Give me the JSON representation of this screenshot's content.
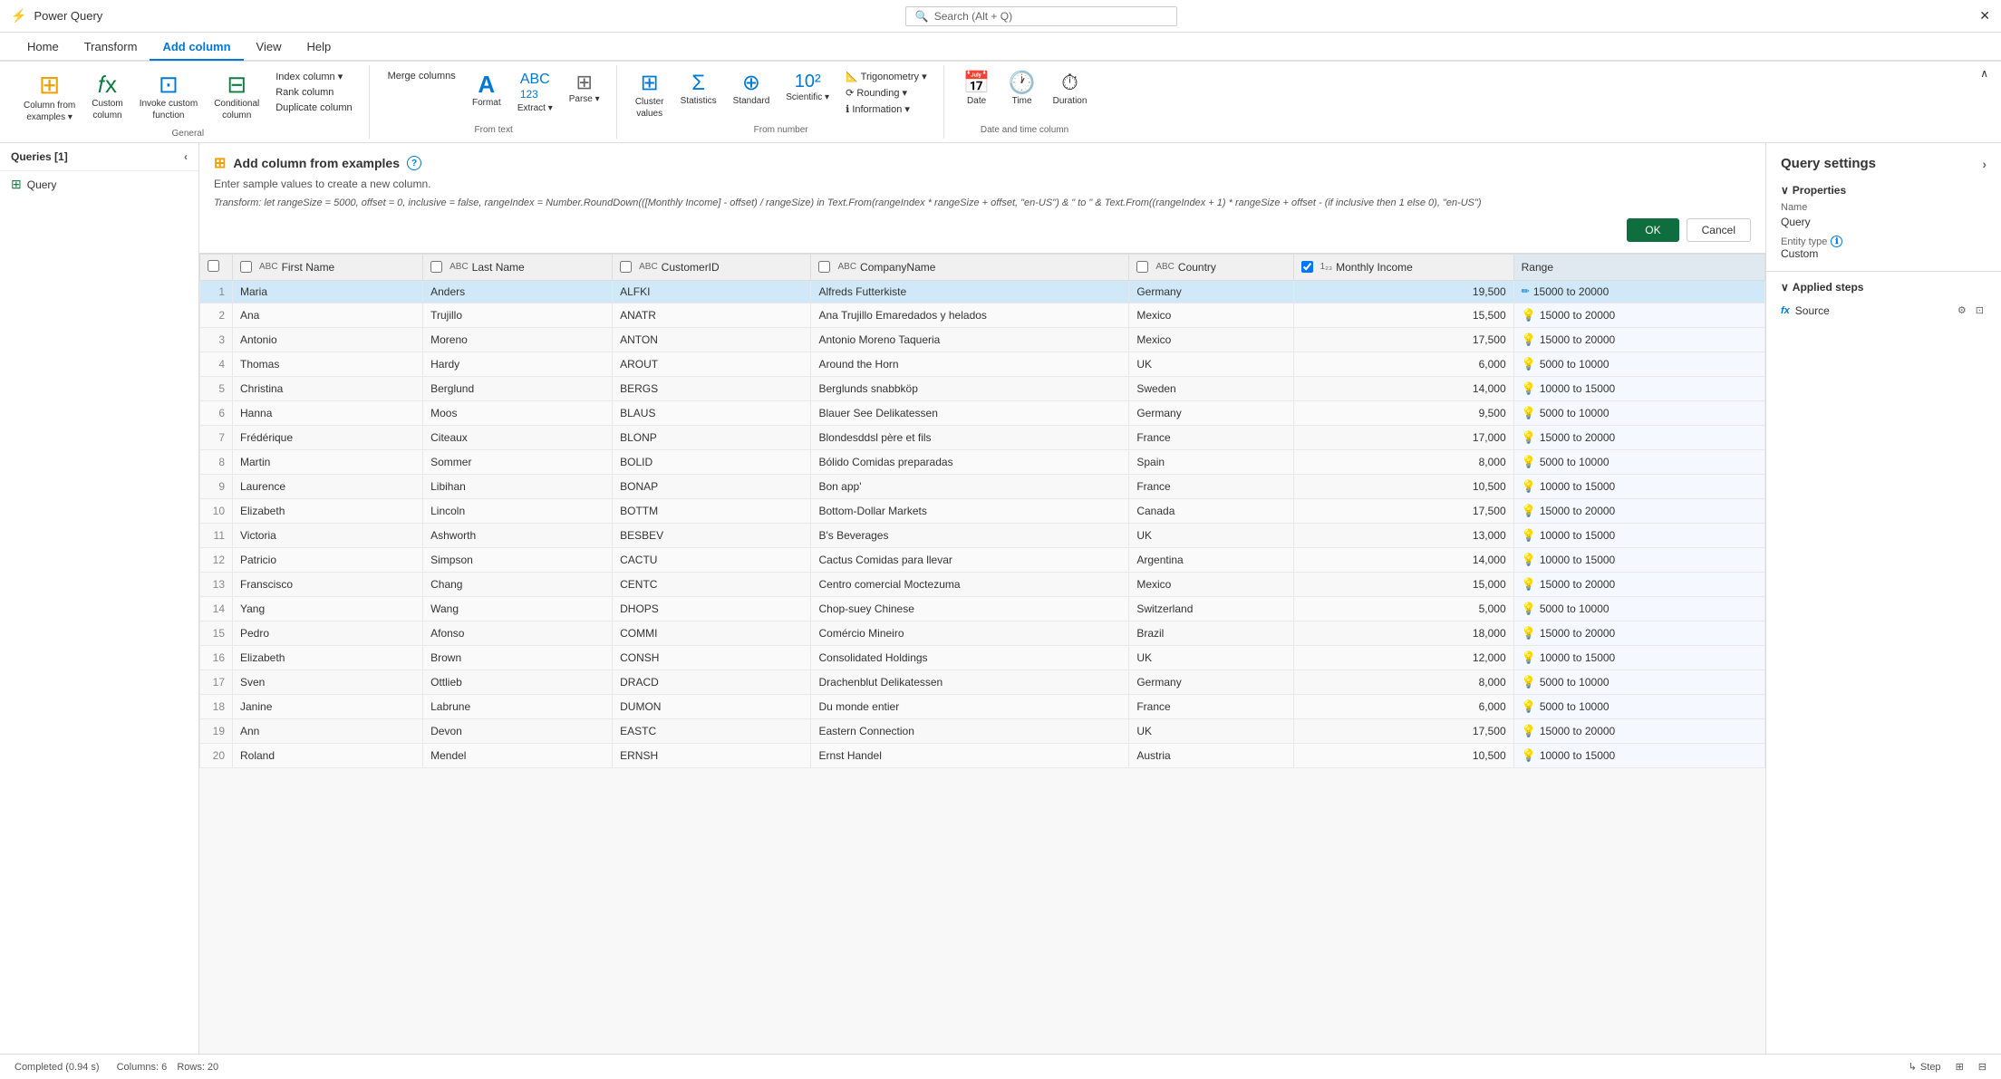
{
  "app": {
    "title": "Power Query",
    "close_label": "✕"
  },
  "search": {
    "placeholder": "Search (Alt + Q)"
  },
  "tabs": [
    {
      "label": "Home",
      "active": false
    },
    {
      "label": "Transform",
      "active": false
    },
    {
      "label": "Add column",
      "active": true
    },
    {
      "label": "View",
      "active": false
    },
    {
      "label": "Help",
      "active": false
    }
  ],
  "ribbon": {
    "groups": [
      {
        "label": "General",
        "items": [
          {
            "label": "Column from\nexamples",
            "icon": "⊞",
            "has_dropdown": true
          },
          {
            "label": "Custom\ncolumn",
            "icon": "𝑓x",
            "has_dropdown": false
          },
          {
            "label": "Invoke custom\nfunction",
            "icon": "⊡",
            "has_dropdown": false
          },
          {
            "label": "Conditional\ncolumn",
            "icon": "⊟",
            "has_dropdown": false
          }
        ],
        "small_items": [
          {
            "label": "Index column ▾"
          },
          {
            "label": "Rank column"
          },
          {
            "label": "Duplicate column"
          }
        ]
      },
      {
        "label": "From text",
        "items": [
          {
            "label": "Format",
            "icon": "A"
          },
          {
            "label": "Extract ▾",
            "icon": "ABC\n123"
          },
          {
            "label": "Parse ▾",
            "icon": "⊞"
          }
        ],
        "small_items": [
          {
            "label": "Merge columns"
          }
        ]
      },
      {
        "label": "From number",
        "items": [
          {
            "label": "Cluster\nvalues",
            "icon": "⊞"
          },
          {
            "label": "Statistics",
            "icon": "Σ"
          },
          {
            "label": "Standard",
            "icon": "σ"
          },
          {
            "label": "Scientific\n▾",
            "icon": "10²"
          }
        ],
        "small_items": [
          {
            "label": "Trigonometry ▾"
          },
          {
            "label": "Rounding ▾"
          },
          {
            "label": "Information ▾"
          }
        ]
      },
      {
        "label": "Date and time column",
        "items": [
          {
            "label": "Date",
            "icon": "📅"
          },
          {
            "label": "Time",
            "icon": "🕐"
          },
          {
            "label": "Duration",
            "icon": "⏱"
          }
        ],
        "small_items": []
      }
    ]
  },
  "queries_panel": {
    "title": "Queries [1]",
    "items": [
      {
        "label": "Query",
        "icon": "table"
      }
    ]
  },
  "examples_panel": {
    "title": "Add column from examples",
    "subtitle": "Enter sample values to create a new column.",
    "transform_label": "Transform:",
    "transform_text": "let rangeSize = 5000, offset = 0, inclusive = false, rangeIndex = Number.RoundDown(([Monthly Income] - offset) / rangeSize) in Text.From(rangeIndex * rangeSize + offset, \"en-US\") & \" to \" & Text.From((rangeIndex + 1) * rangeSize + offset - (if inclusive then 1 else 0), \"en-US\")",
    "ok_label": "OK",
    "cancel_label": "Cancel",
    "info_tooltip": "?"
  },
  "table": {
    "columns": [
      {
        "label": "",
        "type": ""
      },
      {
        "label": "First Name",
        "type": "ABC",
        "checked": false
      },
      {
        "label": "Last Name",
        "type": "ABC",
        "checked": false
      },
      {
        "label": "CustomerID",
        "type": "ABC",
        "checked": false
      },
      {
        "label": "CompanyName",
        "type": "ABC",
        "checked": false
      },
      {
        "label": "Country",
        "type": "ABC",
        "checked": false
      },
      {
        "label": "Monthly Income",
        "type": "123",
        "checked": true
      },
      {
        "label": "Range",
        "type": "",
        "checked": false,
        "is_new": true
      }
    ],
    "rows": [
      {
        "id": 1,
        "first": "Maria",
        "last": "Anders",
        "cid": "ALFKI",
        "company": "Alfreds Futterkiste",
        "country": "Germany",
        "income": 19500,
        "range": "15000 to 20000",
        "range_editing": true
      },
      {
        "id": 2,
        "first": "Ana",
        "last": "Trujillo",
        "cid": "ANATR",
        "company": "Ana Trujillo Emaredados y helados",
        "country": "Mexico",
        "income": 15500,
        "range": "15000 to 20000"
      },
      {
        "id": 3,
        "first": "Antonio",
        "last": "Moreno",
        "cid": "ANTON",
        "company": "Antonio Moreno Taqueria",
        "country": "Mexico",
        "income": 17500,
        "range": "15000 to 20000"
      },
      {
        "id": 4,
        "first": "Thomas",
        "last": "Hardy",
        "cid": "AROUT",
        "company": "Around the Horn",
        "country": "UK",
        "income": 6000,
        "range": "5000 to 10000"
      },
      {
        "id": 5,
        "first": "Christina",
        "last": "Berglund",
        "cid": "BERGS",
        "company": "Berglunds snabbköp",
        "country": "Sweden",
        "income": 14000,
        "range": "10000 to 15000"
      },
      {
        "id": 6,
        "first": "Hanna",
        "last": "Moos",
        "cid": "BLAUS",
        "company": "Blauer See Delikatessen",
        "country": "Germany",
        "income": 9500,
        "range": "5000 to 10000"
      },
      {
        "id": 7,
        "first": "Frédérique",
        "last": "Citeaux",
        "cid": "BLONP",
        "company": "Blondesddsl père et fils",
        "country": "France",
        "income": 17000,
        "range": "15000 to 20000"
      },
      {
        "id": 8,
        "first": "Martin",
        "last": "Sommer",
        "cid": "BOLID",
        "company": "Bólido Comidas preparadas",
        "country": "Spain",
        "income": 8000,
        "range": "5000 to 10000"
      },
      {
        "id": 9,
        "first": "Laurence",
        "last": "Libihan",
        "cid": "BONAP",
        "company": "Bon app'",
        "country": "France",
        "income": 10500,
        "range": "10000 to 15000"
      },
      {
        "id": 10,
        "first": "Elizabeth",
        "last": "Lincoln",
        "cid": "BOTTM",
        "company": "Bottom-Dollar Markets",
        "country": "Canada",
        "income": 17500,
        "range": "15000 to 20000"
      },
      {
        "id": 11,
        "first": "Victoria",
        "last": "Ashworth",
        "cid": "BESBEV",
        "company": "B's Beverages",
        "country": "UK",
        "income": 13000,
        "range": "10000 to 15000"
      },
      {
        "id": 12,
        "first": "Patricio",
        "last": "Simpson",
        "cid": "CACTU",
        "company": "Cactus Comidas para llevar",
        "country": "Argentina",
        "income": 14000,
        "range": "10000 to 15000"
      },
      {
        "id": 13,
        "first": "Franscisco",
        "last": "Chang",
        "cid": "CENTC",
        "company": "Centro comercial Moctezuma",
        "country": "Mexico",
        "income": 15000,
        "range": "15000 to 20000"
      },
      {
        "id": 14,
        "first": "Yang",
        "last": "Wang",
        "cid": "DHOPS",
        "company": "Chop-suey Chinese",
        "country": "Switzerland",
        "income": 5000,
        "range": "5000 to 10000"
      },
      {
        "id": 15,
        "first": "Pedro",
        "last": "Afonso",
        "cid": "COMMI",
        "company": "Comércio Mineiro",
        "country": "Brazil",
        "income": 18000,
        "range": "15000 to 20000"
      },
      {
        "id": 16,
        "first": "Elizabeth",
        "last": "Brown",
        "cid": "CONSH",
        "company": "Consolidated Holdings",
        "country": "UK",
        "income": 12000,
        "range": "10000 to 15000"
      },
      {
        "id": 17,
        "first": "Sven",
        "last": "Ottlieb",
        "cid": "DRACD",
        "company": "Drachenblut Delikatessen",
        "country": "Germany",
        "income": 8000,
        "range": "5000 to 10000"
      },
      {
        "id": 18,
        "first": "Janine",
        "last": "Labrune",
        "cid": "DUMON",
        "company": "Du monde entier",
        "country": "France",
        "income": 6000,
        "range": "5000 to 10000"
      },
      {
        "id": 19,
        "first": "Ann",
        "last": "Devon",
        "cid": "EASTC",
        "company": "Eastern Connection",
        "country": "UK",
        "income": 17500,
        "range": "15000 to 20000"
      },
      {
        "id": 20,
        "first": "Roland",
        "last": "Mendel",
        "cid": "ERNSH",
        "company": "Ernst Handel",
        "country": "Austria",
        "income": 10500,
        "range": "10000 to 15000"
      }
    ]
  },
  "query_settings": {
    "title": "Query settings",
    "chevron_label": "›",
    "properties_label": "Properties",
    "name_label": "Name",
    "name_value": "Query",
    "entity_type_label": "Entity type",
    "entity_type_info": "ℹ",
    "entity_type_value": "Custom",
    "applied_steps_label": "Applied steps",
    "steps": [
      {
        "label": "Source",
        "has_gear": true,
        "has_nav": true
      }
    ]
  },
  "status_bar": {
    "status_text": "Completed (0.94 s)",
    "columns_text": "Columns: 6",
    "rows_text": "Rows: 20",
    "step_label": "Step",
    "view_label": "⊞",
    "table_label": "⊟"
  }
}
